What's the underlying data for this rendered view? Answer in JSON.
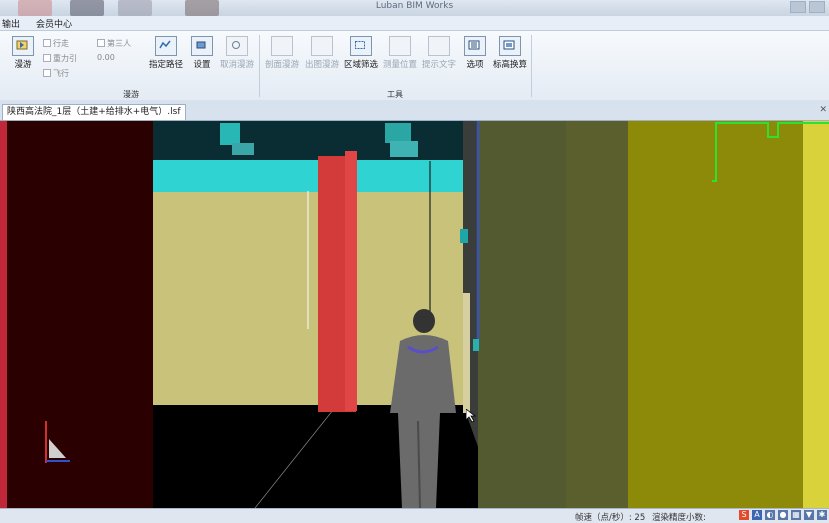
{
  "window": {
    "title": "Luban BIM Works"
  },
  "menu": {
    "items": [
      "输出",
      "会员中心"
    ]
  },
  "ribbon": {
    "groups": [
      {
        "label": "漫游"
      },
      {
        "label": "工具"
      }
    ],
    "buttons": {
      "roam": "漫游",
      "set_path": "指定路径",
      "settings": "设置",
      "deselect": "取消漫游",
      "t1": "剖面漫游",
      "t2": "出图漫游",
      "region_select": "区域筛选",
      "t4": "测量位置",
      "t5": "提示文字",
      "options": "选项",
      "calc": "标高换算"
    },
    "options": {
      "walk": "行走",
      "gravity": "重力引",
      "fly": "飞行",
      "third_person": "第三人",
      "value": "0.00"
    }
  },
  "document_tab": {
    "label": "陕西高法院_1层（土建+给排水+电气）.lsf"
  },
  "status": {
    "frame_label": "帧速（点/秒）: 25",
    "render_label": "渲染精度小数:"
  },
  "tray_icons": [
    "sogou-icon",
    "font-icon",
    "moon-icon",
    "mic-icon",
    "keyboard-icon",
    "shirt-icon",
    "settings-icon"
  ]
}
